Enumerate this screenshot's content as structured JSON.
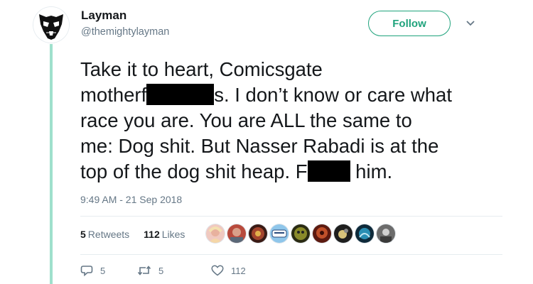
{
  "user": {
    "display_name": "Layman",
    "handle": "@themightylayman"
  },
  "follow_label": "Follow",
  "tweet": {
    "line1": "Take it to heart, Comicsgate",
    "line2_start": "motherf",
    "line2_end": "s. I don’t know or care what",
    "line3": "race you are. You are ALL the same to",
    "line4": "me: Dog shit. But Nasser Rabadi is at the",
    "line5_start": "top of the dog shit heap. F",
    "line5_end": " him."
  },
  "timestamp": "9:49 AM - 21 Sep 2018",
  "stats": {
    "retweets_count": "5",
    "retweets_label": "Retweets",
    "likes_count": "112",
    "likes_label": "Likes"
  },
  "liker_avatars": [
    "liker-avatar-1",
    "liker-avatar-2",
    "liker-avatar-3",
    "liker-avatar-4",
    "liker-avatar-5",
    "liker-avatar-6",
    "liker-avatar-7",
    "liker-avatar-8",
    "liker-avatar-9"
  ],
  "actions": {
    "reply_count": "5",
    "retweet_count": "5",
    "like_count": "112"
  },
  "colors": {
    "accent": "#1fa37c",
    "thread_line": "#9fe0cc",
    "muted": "#657786"
  }
}
